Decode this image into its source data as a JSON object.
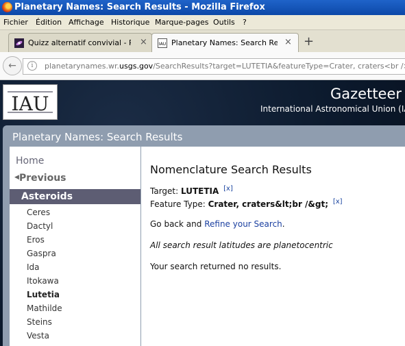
{
  "window": {
    "title": "Planetary Names: Search Results - Mozilla Firefox"
  },
  "menu": [
    {
      "label": "Fichier"
    },
    {
      "label": "Édition"
    },
    {
      "label": "Affichage"
    },
    {
      "label": "Historique"
    },
    {
      "label": "Marque-pages"
    },
    {
      "label": "Outils"
    },
    {
      "label": "?"
    }
  ],
  "tabs": [
    {
      "label": "Quizz alternatif convivial - Pa…",
      "close": "×"
    },
    {
      "label": "Planetary Names: Search Res…",
      "close": "×"
    }
  ],
  "new_tab": "+",
  "url": {
    "prefix": "planetarynames.wr.",
    "domain": "usgs.gov",
    "path": "/SearchResults?target=LUTETIA&featureType=Crater, craters<br />"
  },
  "header": {
    "logo_text": "IAU",
    "gazetteer": "Gazetteer o",
    "org": "International Astronomical Union (IAU"
  },
  "page_title": "Planetary Names: Search Results",
  "sidebar": {
    "home": "Home",
    "previous": "Previous",
    "section": "Asteroids",
    "items": [
      "Ceres",
      "Dactyl",
      "Eros",
      "Gaspra",
      "Ida",
      "Itokawa",
      "Lutetia",
      "Mathilde",
      "Steins",
      "Vesta"
    ],
    "current": "Lutetia"
  },
  "main": {
    "title": "Nomenclature Search Results",
    "target_label": "Target:",
    "target_value": "LUTETIA",
    "feature_label": "Feature Type:",
    "feature_value": "Crater, craters&lt;br /&gt;",
    "ext_mark": "[x]",
    "goback_text": "Go back and",
    "refine_link": "Refine your Search",
    "period": ".",
    "note": "All search result latitudes are planetocentric",
    "result": "Your search returned no results."
  },
  "colors": {
    "titlebar": "#0c48a8",
    "menubar": "#ece9d8",
    "page_bg": "#0c1a2d",
    "nav_highlight": "#5d5d73",
    "link": "#1a3fa0"
  }
}
